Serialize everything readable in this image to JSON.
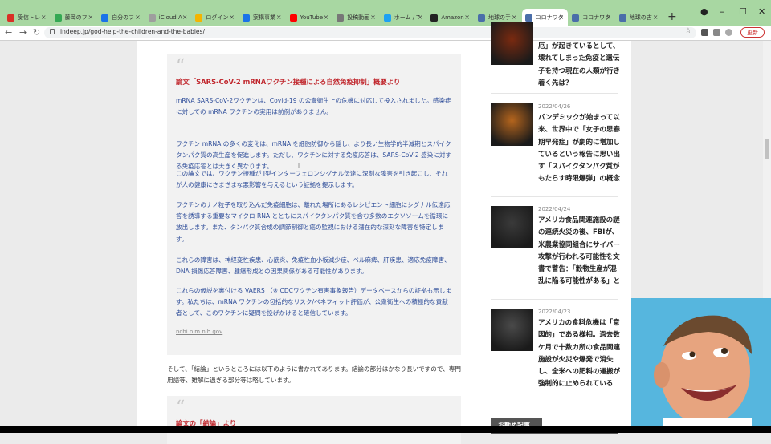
{
  "browser": {
    "tabs": [
      {
        "label": "受信トレ",
        "color": "#d93025"
      },
      {
        "label": "藤岡のフ",
        "color": "#34a853"
      },
      {
        "label": "自分のフ",
        "color": "#1a73e8"
      },
      {
        "label": "iCloud A",
        "color": "#9e9e9e"
      },
      {
        "label": "ログイン",
        "color": "#f4b400"
      },
      {
        "label": "案構事業",
        "color": "#1a73e8"
      },
      {
        "label": "YouTube",
        "color": "#ff0000"
      },
      {
        "label": "投稿動画",
        "color": "#777777"
      },
      {
        "label": "ホーム / T",
        "color": "#1da1f2"
      },
      {
        "label": "Amazon",
        "color": "#222222"
      },
      {
        "label": "地球の手",
        "color": "#4a6ea9"
      },
      {
        "label": "コロナワク",
        "color": "#4a6ea9"
      },
      {
        "label": "コロナワク",
        "color": "#4a6ea9"
      },
      {
        "label": "地球の古",
        "color": "#4a6ea9"
      }
    ],
    "active_tab_index": 11,
    "new_tab": "+",
    "url": "indeep.jp/god-help-the-children-and-the-babies/",
    "update_label": "更新"
  },
  "article": {
    "quote1": {
      "title": "論文「SARS-CoV-2 mRNAワクチン接種による自然免疫抑制」概要より",
      "paragraphs": [
        "mRNA SARS-CoV-2ワクチンは、Covid-19 の公衆衛生上の危機に対応して投入されました。感染症に対しての mRNA ワクチンの実用は前例がありません。",
        "ワクチン mRNA の多くの変化は、mRNA を細胞防御から隠し、より長い生物学的半減期とスパイクタンパク質の高生産を促進します。ただし、ワクチンに対する免疫応答は、SARS-CoV-2 感染に対する免疫応答とは大きく異なります。",
        "この論文では、ワクチン接種が I型インターフェロンシグナル伝達に深刻な障害を引き起こし、それが人の健康にさまざまな悪影響を与えるという証拠を提示します。",
        "ワクチンのナノ粒子を取り込んだ免疫細胞は、離れた場所にあるレシピエント細胞にシグナル伝達応答を誘導する重要なマイクロ RNA とともにスパイクタンパク質を含む多数のエクソソームを循環に放出します。また、タンパク質合成の調節制御と癌の監視における潜在的な深刻な障害を特定します。",
        "これらの障害は、神経変性疾患、心筋炎、免疫性血小板減少症、ベル麻痺、肝疾患、適応免疫障害、DNA 損傷応答障害、腫瘍形成との因果関係がある可能性があります。",
        "これらの仮説を裏付ける VAERS （※ CDCワクチン有害事象報告）データベースからの証拠も示します。私たちは、mRNA ワクチンの包括的なリスク/ベネフィット評価が、公衆衛生への積極的な貢献者として、このワクチンに疑問を投げかけると確信しています。"
      ],
      "source": "ncbi.nlm.nih.gov"
    },
    "body": "そして、「結論」というところには以下のように書かれてあります。結論の部分はかなり長いですので、専門用語等、難解に過ぎる部分等は略しています。",
    "quote2_title": "論文の「結論」より"
  },
  "sidebar": {
    "items": [
      {
        "date": "",
        "title": "厄」が起きているとして、壊れてしまった免疫と遺伝子を持つ現在の人類が行き着く先は？",
        "thumb": "#7a2a10"
      },
      {
        "date": "2022/04/26",
        "title": "パンデミックが始まって以来、世界中で「女子の思春期早発症」が劇的に増加しているという報告に思い出す「スパイクタンパク質がもたらす時限爆弾」の概念",
        "thumb": "#b5651d"
      },
      {
        "date": "2022/04/24",
        "title": "アメリカ食品関連施設の謎の連続火災の後、FBIが、米農業協同組合にサイバー攻撃が行われる可能性を文書で警告：「穀物生産が混乱に陥る可能性がある」と",
        "thumb": "#3a3a3a"
      },
      {
        "date": "2022/04/23",
        "title": "アメリカの食料危機は「意図的」である様相。過去数ケ月で十数カ所の食品関連施設が火災や爆発で消失し、全米への肥料の運搬が強制的に止められている",
        "thumb": "#4a4a4a"
      }
    ],
    "recommended_label": "お勧め記事"
  }
}
